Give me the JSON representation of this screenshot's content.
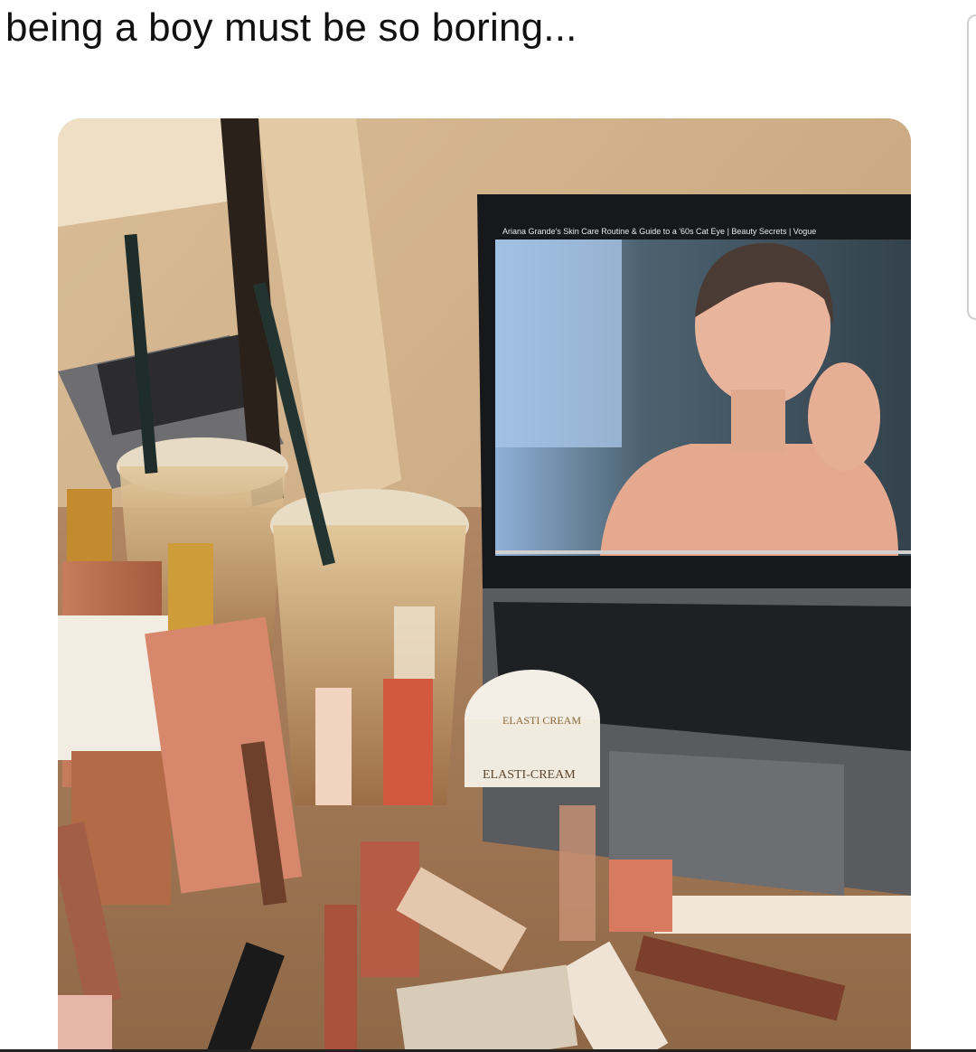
{
  "post": {
    "caption": "being a boy must be so boring..."
  },
  "video": {
    "title": "Ariana Grande's Skin Care Routine & Guide to a '60s Cat Eye | Beauty Secrets | Vogue"
  },
  "products": {
    "jar_label": "ELASTI-CREAM",
    "jar_lid_text": "ELASTI CREAM"
  },
  "colors": {
    "wall": "#cdb08e",
    "desk": "#a27a57",
    "laptop_body": "#5a5b5e",
    "screen_bezel": "#16181c",
    "video_bg": "#5b6e7e"
  }
}
